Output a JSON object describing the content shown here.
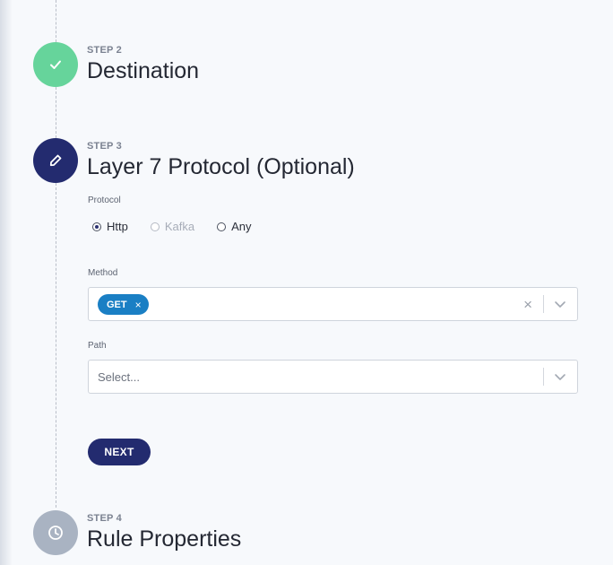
{
  "steps": [
    {
      "label": "STEP 2",
      "title": "Destination",
      "state": "completed",
      "icon": "check-icon"
    },
    {
      "label": "STEP 3",
      "title": "Layer 7 Protocol (Optional)",
      "state": "active",
      "icon": "pencil-icon"
    },
    {
      "label": "STEP 4",
      "title": "Rule Properties",
      "state": "pending",
      "icon": "clock-icon"
    }
  ],
  "form": {
    "protocol": {
      "label": "Protocol",
      "options": [
        {
          "label": "Http",
          "selected": true,
          "disabled": false
        },
        {
          "label": "Kafka",
          "selected": false,
          "disabled": true
        },
        {
          "label": "Any",
          "selected": false,
          "disabled": false
        }
      ]
    },
    "method": {
      "label": "Method",
      "chips": [
        "GET"
      ],
      "chip_remove_glyph": "×",
      "clear_glyph": "×"
    },
    "path": {
      "label": "Path",
      "placeholder": "Select..."
    },
    "next_label": "NEXT"
  },
  "colors": {
    "completed": "#66d49b",
    "active": "#232b6f",
    "pending": "#a9b3c2",
    "chip": "#1a7fc4",
    "background": "#f7f9fc"
  }
}
